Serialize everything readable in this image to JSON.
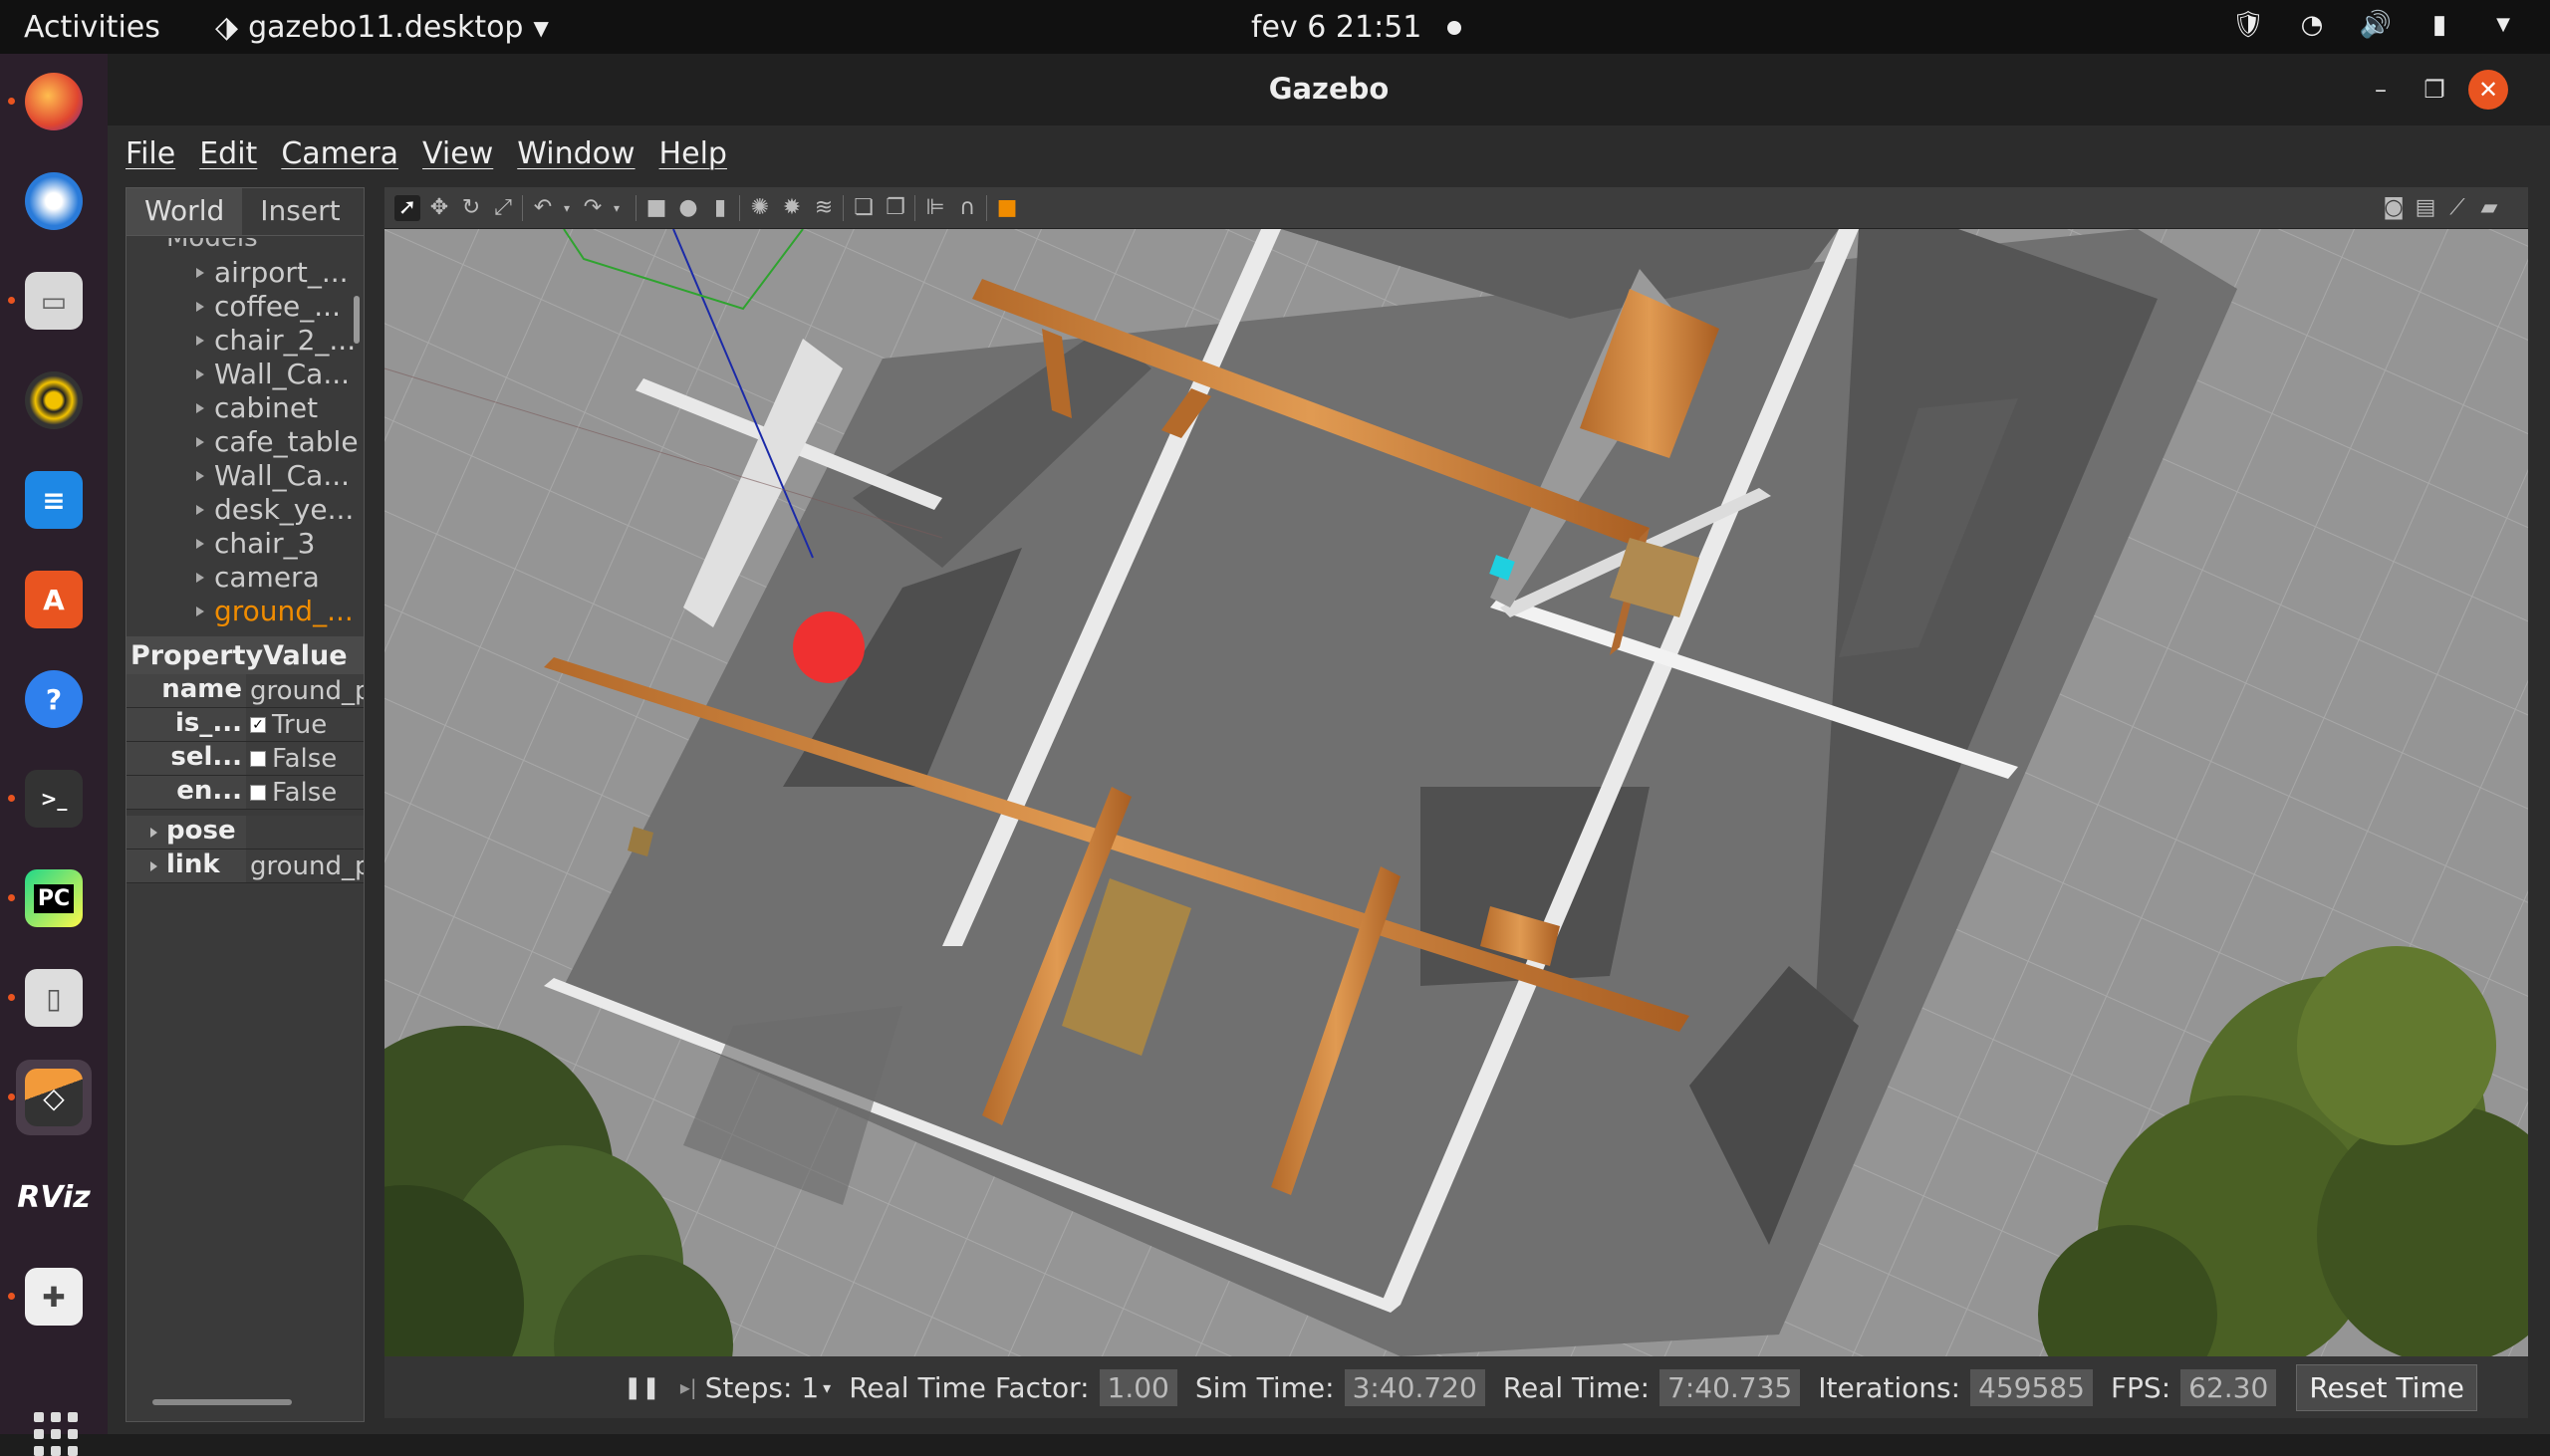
{
  "topbar": {
    "activities": "Activities",
    "app_name": "gazebo11.desktop",
    "datetime": "fev 6  21:51"
  },
  "dock": {
    "items": [
      "firefox-icon",
      "thunderbird-icon",
      "files-icon",
      "rhythmbox-icon",
      "writer-icon",
      "software-icon",
      "help-icon",
      "terminal-icon",
      "pycharm-icon",
      "usb-icon",
      "gazebo-icon",
      "rviz-icon",
      "game-icon"
    ],
    "rviz_label": "RViz",
    "pycharm_label": "PC"
  },
  "window": {
    "title": "Gazebo"
  },
  "menu": {
    "file": "File",
    "edit": "Edit",
    "camera": "Camera",
    "view": "View",
    "window": "Window",
    "help": "Help"
  },
  "left_panel": {
    "tabs": [
      "World",
      "Insert"
    ],
    "models_header": "Models",
    "models": [
      "airport_...",
      "coffee_...",
      "chair_2_...",
      "Wall_Ca...",
      "cabinet",
      "cafe_table",
      "Wall_Ca...",
      "desk_ye...",
      "chair_3",
      "camera",
      "ground_..."
    ],
    "selected_model_index": 10,
    "props_header": "PropertyValue",
    "props": [
      {
        "key": "name",
        "value": "ground_p",
        "type": "text"
      },
      {
        "key": "is_...",
        "value": "True",
        "type": "check",
        "checked": true
      },
      {
        "key": "sel...",
        "value": "False",
        "type": "check",
        "checked": false
      },
      {
        "key": "en...",
        "value": "False",
        "type": "check",
        "checked": false
      }
    ],
    "groups": [
      {
        "key": "pose",
        "value": ""
      },
      {
        "key": "link",
        "value": "ground_p"
      }
    ]
  },
  "statusbar": {
    "steps_label": "Steps: 1",
    "rtf_label": "Real Time Factor:",
    "rtf_value": "1.00",
    "sim_label": "Sim Time:",
    "sim_value": "3:40.720",
    "real_label": "Real Time:",
    "real_value": "7:40.735",
    "iter_label": "Iterations:",
    "iter_value": "459585",
    "fps_label": "FPS:",
    "fps_value": "62.30",
    "reset_label": "Reset Time"
  }
}
